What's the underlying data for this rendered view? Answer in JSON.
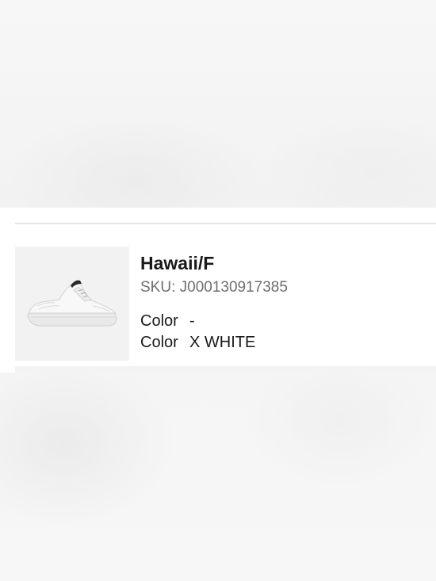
{
  "product": {
    "name": "Hawaii/F",
    "sku": "SKU: J000130917385",
    "image_icon": "sneaker-image"
  },
  "attributes": [
    {
      "label": "Color",
      "value": "-"
    },
    {
      "label": "Color",
      "value": "X WHITE"
    }
  ],
  "colors": {
    "name_text": "#1a1a1a",
    "sku_text": "#6f6f6f",
    "thumb_bg": "#f2f2f2",
    "divider": "#e6e6e6"
  }
}
